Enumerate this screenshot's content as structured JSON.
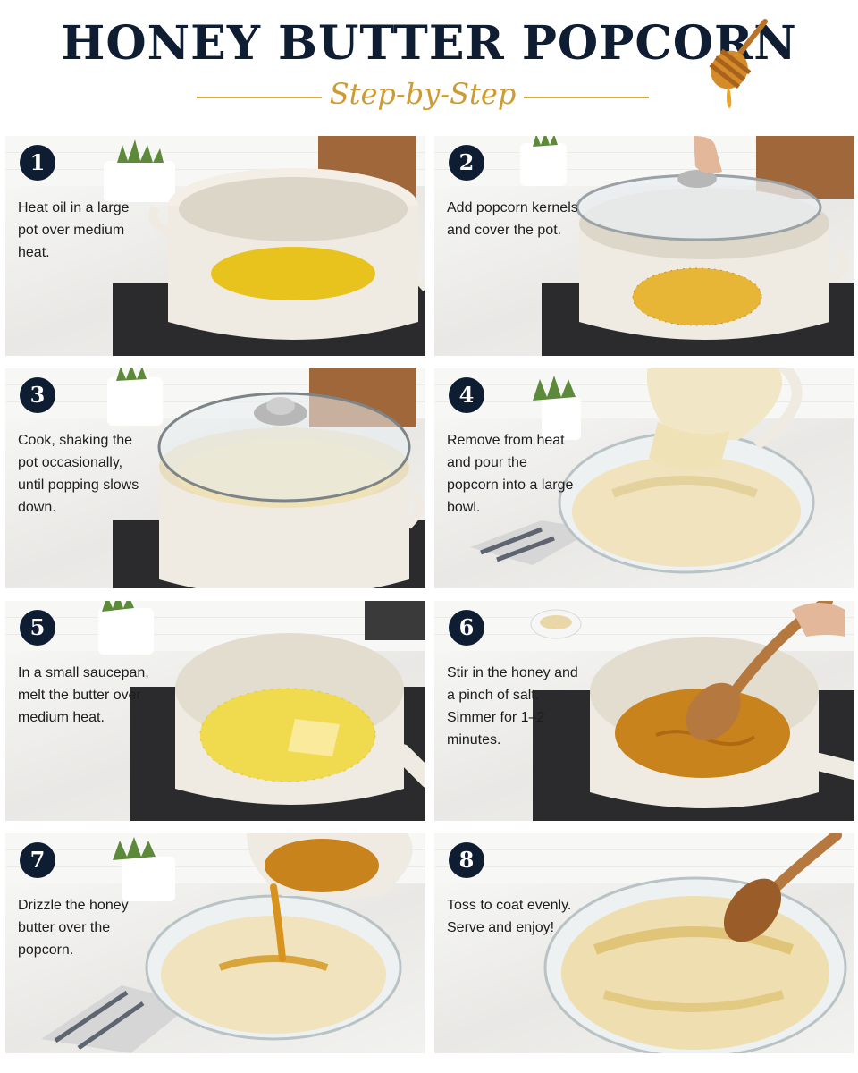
{
  "header": {
    "title": "HONEY BUTTER POPCORN",
    "subtitle": "Step-by-Step",
    "accent_color": "#d8a83a",
    "title_color": "#0f1d33",
    "icon": "honey-dipper-icon"
  },
  "steps": [
    {
      "number": "1",
      "text": "Heat oil in a large pot over medium heat."
    },
    {
      "number": "2",
      "text": "Add popcorn kernels and cover the pot."
    },
    {
      "number": "3",
      "text": "Cook, shaking the pot occasionally, until popping slows down."
    },
    {
      "number": "4",
      "text": "Remove from heat and pour the popcorn into a large bowl."
    },
    {
      "number": "5",
      "text": "In a small saucepan, melt the butter over medium heat."
    },
    {
      "number": "6",
      "text": "Stir in the honey and a pinch of salt. Simmer for 1–2 minutes."
    },
    {
      "number": "7",
      "text": "Drizzle the honey butter over the popcorn."
    },
    {
      "number": "8",
      "text": "Toss to coat evenly. Serve and enjoy!"
    }
  ]
}
